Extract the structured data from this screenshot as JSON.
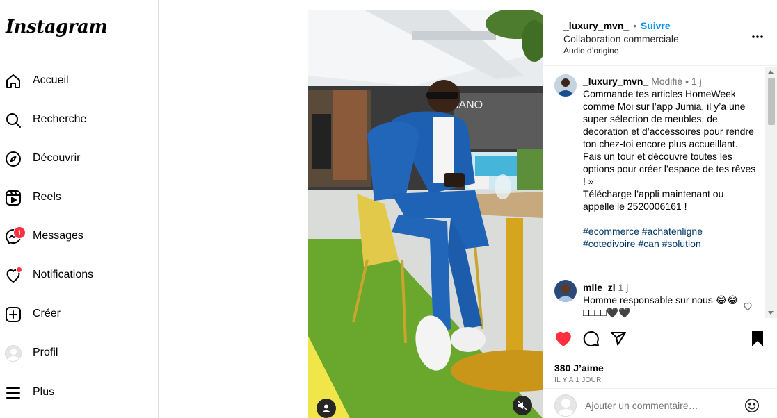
{
  "app": {
    "logo": "Instagram"
  },
  "sidebar": {
    "items": [
      {
        "label": "Accueil",
        "icon": "home-icon"
      },
      {
        "label": "Recherche",
        "icon": "search-icon"
      },
      {
        "label": "Découvrir",
        "icon": "compass-icon"
      },
      {
        "label": "Reels",
        "icon": "reels-icon"
      },
      {
        "label": "Messages",
        "icon": "messenger-icon",
        "badge": "1"
      },
      {
        "label": "Notifications",
        "icon": "heart-icon"
      },
      {
        "label": "Créer",
        "icon": "create-icon"
      },
      {
        "label": "Profil",
        "icon": "avatar"
      },
      {
        "label": "Plus",
        "icon": "menu-icon"
      }
    ]
  },
  "post": {
    "author": "_luxury_mvn_",
    "separator": "•",
    "follow_label": "Suivre",
    "subtitle": "Collaboration commerciale",
    "audio": "Audio d’origine",
    "caption": {
      "author": "_luxury_mvn_",
      "edited": "Modifié",
      "dot": "•",
      "age": "1 j",
      "lines": [
        "Commande tes articles HomeWeek",
        "comme Moi sur l’app Jumia, il y’a une",
        "super sélection de meubles, de",
        "décoration et d’accessoires pour rendre",
        "ton chez-toi encore plus accueillant.",
        "Fais un tour et découvre toutes les",
        "options pour créer l’espace de tes rêves",
        "! »",
        "Télécharge l’appli maintenant ou",
        "appelle le 2520006161 !"
      ],
      "hashtags_line1": "#ecommerce #achatenligne",
      "hashtags_line2": "#cotedivoire #can #solution"
    },
    "comment": {
      "author": "mlle_zl",
      "age": "1 j",
      "text_line1": "Homme responsable sur nous 😂😂",
      "text_line2": "□□□□🖤🖤"
    },
    "likes": "380 J’aime",
    "timestamp": "IL Y A 1 JOUR",
    "add_comment_placeholder": "Ajouter un commentaire…"
  },
  "colors": {
    "accent": "#0095f6",
    "like": "#ff3040",
    "badge": "#ff3040"
  }
}
